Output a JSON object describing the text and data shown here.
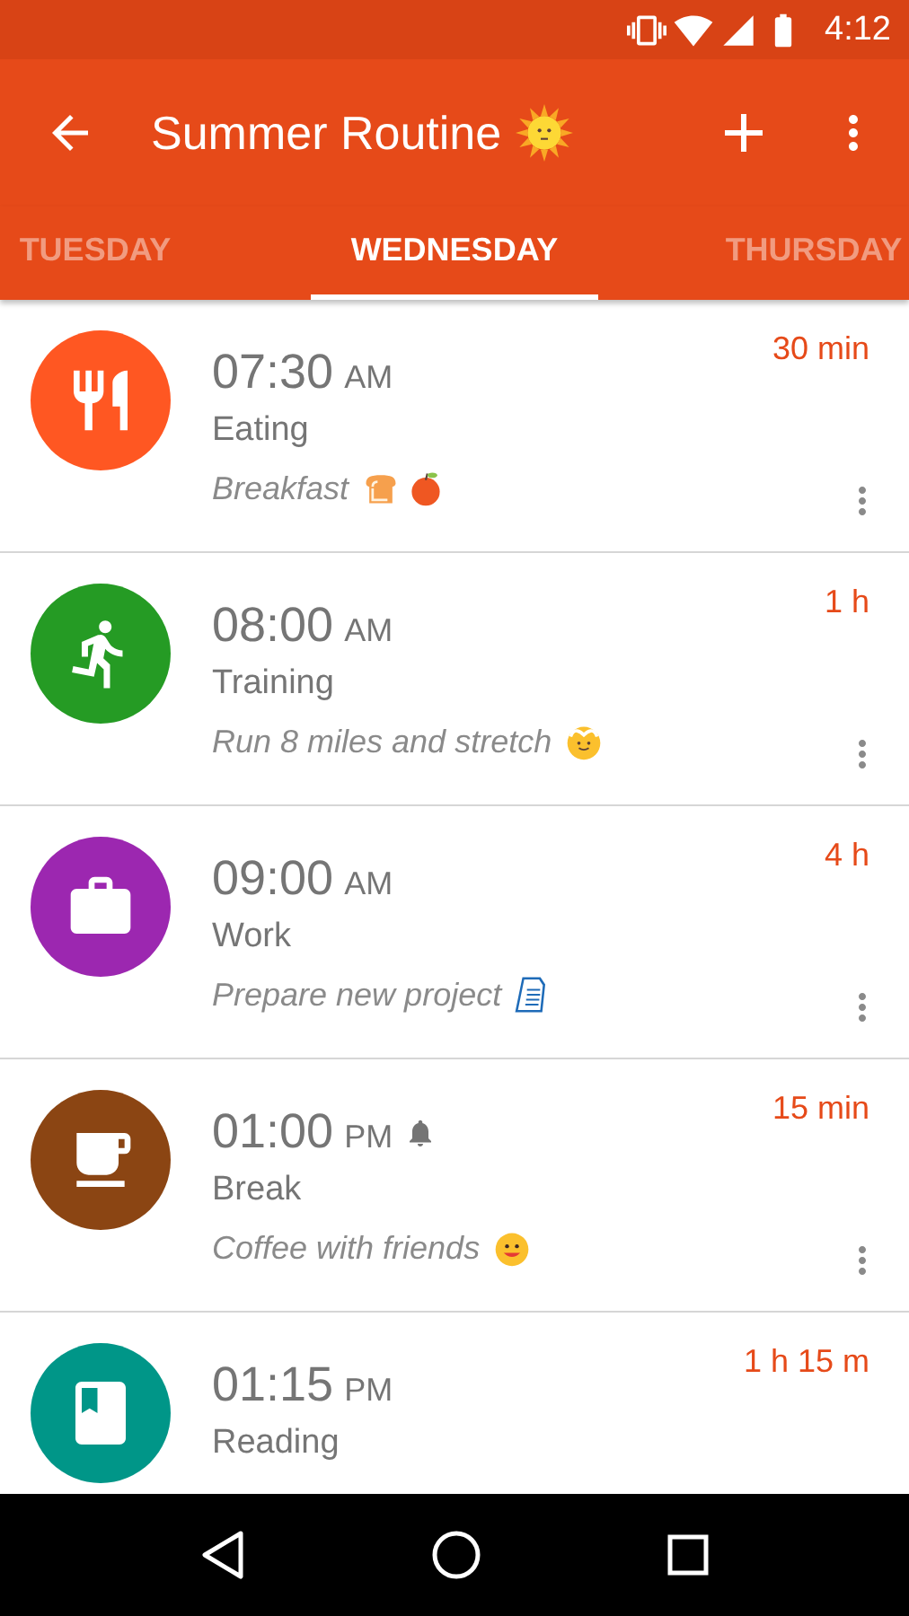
{
  "status_bar": {
    "time": "4:12"
  },
  "app_bar": {
    "title": "Summer Routine"
  },
  "tabs": [
    {
      "label": "TUESDAY",
      "selected": false
    },
    {
      "label": "WEDNESDAY",
      "selected": true
    },
    {
      "label": "THURSDAY",
      "selected": false
    }
  ],
  "activities": [
    {
      "kind": "meal",
      "color": "#ff5722",
      "time": "07:30",
      "period": "AM",
      "alarm": false,
      "category": "Eating",
      "note": "Breakfast",
      "duration": "30 min"
    },
    {
      "kind": "run",
      "color": "#259b24",
      "time": "08:00",
      "period": "AM",
      "alarm": false,
      "category": "Training",
      "note": "Run 8 miles and stretch",
      "duration": "1 h"
    },
    {
      "kind": "work",
      "color": "#9c27b0",
      "time": "09:00",
      "period": "AM",
      "alarm": false,
      "category": "Work",
      "note": "Prepare new project",
      "duration": "4 h"
    },
    {
      "kind": "coffee",
      "color": "#8b4513",
      "time": "01:00",
      "period": "PM",
      "alarm": true,
      "category": "Break",
      "note": "Coffee with friends",
      "duration": "15 min"
    },
    {
      "kind": "book",
      "color": "#009688",
      "time": "01:15",
      "period": "PM",
      "alarm": false,
      "category": "Reading",
      "duration": "1 h 15 m"
    }
  ]
}
